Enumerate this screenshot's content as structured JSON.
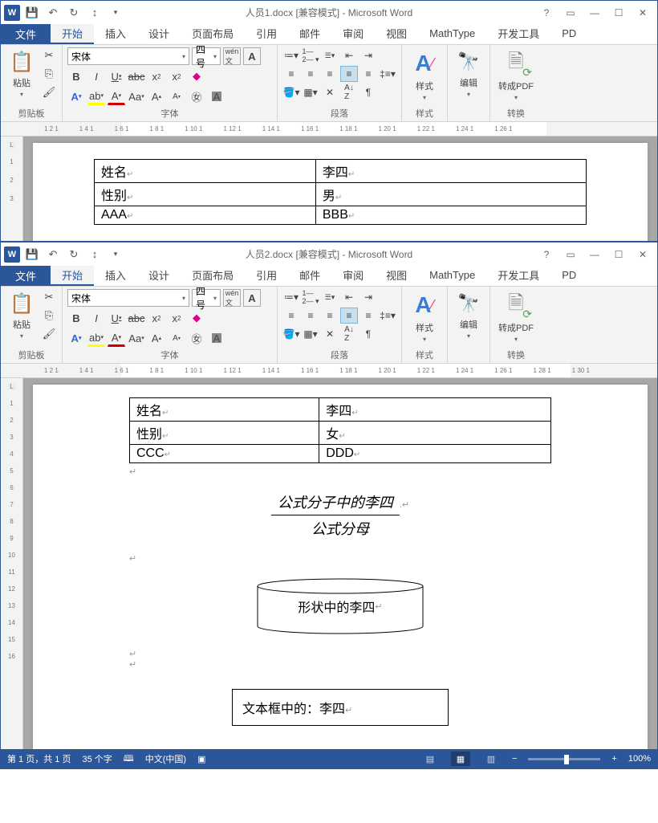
{
  "windows": [
    {
      "title": "人员1.docx [兼容模式] - Microsoft Word",
      "doc": {
        "table": [
          {
            "c1": "姓名",
            "c2": "李四"
          },
          {
            "c1": "性别",
            "c2": "男"
          },
          {
            "c1": "AAA",
            "c2": "BBB"
          }
        ]
      }
    },
    {
      "title": "人员2.docx [兼容模式] - Microsoft Word",
      "doc": {
        "table": [
          {
            "c1": "姓名",
            "c2": "李四"
          },
          {
            "c1": "性别",
            "c2": "女"
          },
          {
            "c1": "CCC",
            "c2": "DDD"
          }
        ],
        "formula_top": "公式分子中的李四",
        "formula_bot": "公式分母",
        "shape_text": "形状中的李四",
        "textbox_text": "文本框中的：李四"
      }
    }
  ],
  "tabs": {
    "file": "文件",
    "items": [
      "开始",
      "插入",
      "设计",
      "页面布局",
      "引用",
      "邮件",
      "审阅",
      "视图",
      "MathType",
      "开发工具",
      "PD"
    ]
  },
  "font": {
    "name": "宋体",
    "size": "四号"
  },
  "groups": {
    "clipboard": "剪贴板",
    "paste": "粘贴",
    "font": "字体",
    "paragraph": "段落",
    "styles": "样式",
    "styles_btn": "样式",
    "editing": "编辑",
    "convert": "转换",
    "pdf": "转成PDF"
  },
  "ruler_h": [
    "",
    "1 2 1",
    "1 4 1",
    "1 6 1",
    "1 8 1",
    "1 10 1",
    "1 12 1",
    "1 14 1",
    "1 16 1",
    "1 18 1",
    "1 20 1",
    "1 22 1",
    "1 24 1",
    "1 26 1"
  ],
  "ruler_h2": [
    "",
    "1 2 1",
    "1 4 1",
    "1 6 1",
    "1 8 1",
    "1 10 1",
    "1 12 1",
    "1 14 1",
    "1 16 1",
    "1 18 1",
    "1 20 1",
    "1 22 1",
    "1 24 1",
    "1 26 1",
    "1 28 1",
    "1 30 1"
  ],
  "ruler_v1": [
    "1",
    "2",
    "3"
  ],
  "ruler_v2": [
    "1",
    "2",
    "3",
    "4",
    "5",
    "6",
    "7",
    "8",
    "9",
    "10",
    "11",
    "12",
    "13",
    "14",
    "15",
    "16"
  ],
  "status": {
    "page": "第 1 页，共 1 页",
    "words": "35 个字",
    "lang": "中文(中国)",
    "zoom": "100%"
  }
}
